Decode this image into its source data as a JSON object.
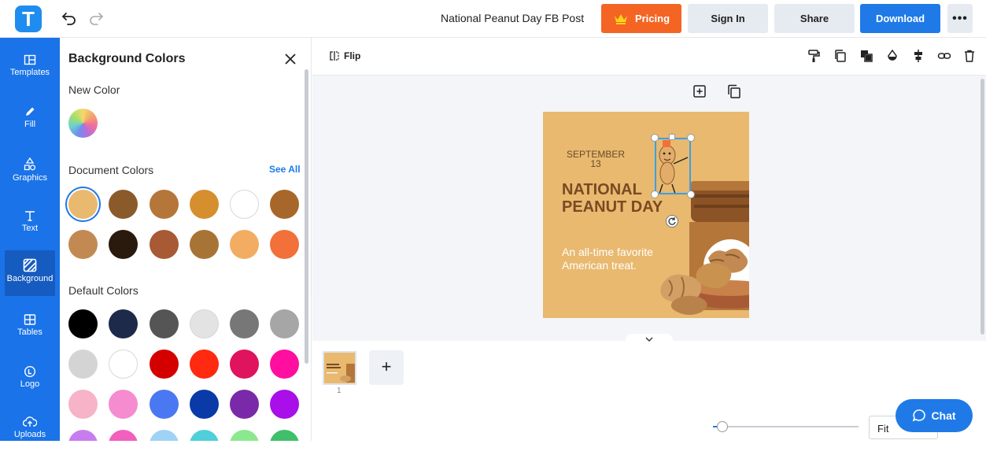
{
  "app": {
    "logo_letter": "T"
  },
  "header": {
    "document_title": "National Peanut Day FB Post",
    "pricing_label": "Pricing",
    "signin_label": "Sign In",
    "share_label": "Share",
    "download_label": "Download",
    "more_label": "•••"
  },
  "rail": {
    "items": [
      {
        "label": "Templates",
        "icon": "templates-icon"
      },
      {
        "label": "Fill",
        "icon": "pencil-icon"
      },
      {
        "label": "Graphics",
        "icon": "shapes-icon"
      },
      {
        "label": "Text",
        "icon": "text-icon"
      },
      {
        "label": "Background",
        "icon": "background-icon",
        "active": true
      },
      {
        "label": "Tables",
        "icon": "table-icon"
      },
      {
        "label": "Logo",
        "icon": "logo-icon"
      },
      {
        "label": "Uploads",
        "icon": "upload-icon"
      }
    ]
  },
  "panel": {
    "title": "Background Colors",
    "new_color_label": "New Color",
    "document_colors_label": "Document Colors",
    "see_all_label": "See All",
    "default_colors_label": "Default Colors",
    "document_colors": [
      "#e8b96f",
      "#8b5a2b",
      "#b5763a",
      "#d68f2e",
      "#ffffff",
      "#a8672a",
      "#c28a52",
      "#2a1a0d",
      "#a85a35",
      "#a87436",
      "#f2ad62",
      "#f2703a"
    ],
    "default_colors": [
      "#000000",
      "#1e2a4a",
      "#555555",
      "#e3e3e3",
      "#777777",
      "#a6a6a6",
      "#d4d4d4",
      "#ffffff",
      "#d40000",
      "#ff2a10",
      "#e0135e",
      "#ff0ea0",
      "#f7b3c7",
      "#f58ccf",
      "#4a78f2",
      "#0a3aa8",
      "#7a2aa8",
      "#a90fe8",
      "#c77df0",
      "#f260be",
      "#9fd3f5",
      "#4fd0d8",
      "#8ce88e",
      "#3fbf6a"
    ]
  },
  "toolbar": {
    "flip_label": "Flip"
  },
  "design": {
    "date_month": "SEPTEMBER",
    "date_day": "13",
    "headline_line1": "NATIONAL",
    "headline_line2": "PEANUT DAY",
    "sub_line1": "An all-time favorite",
    "sub_line2": "American treat.",
    "bg_color": "#e8b96f"
  },
  "pages": {
    "current_page_number": "1",
    "add_label": "+"
  },
  "zoom": {
    "fit_label": "Fit"
  },
  "chat": {
    "label": "Chat"
  }
}
